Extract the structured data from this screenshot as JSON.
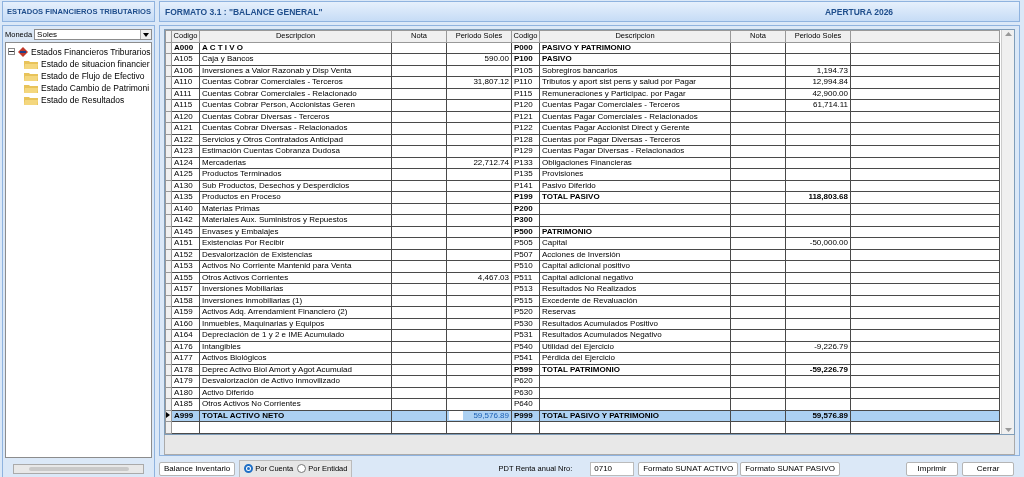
{
  "sidebar": {
    "title": "ESTADOS FINANCIEROS TRIBUTARIOS",
    "moneda": {
      "label": "Moneda",
      "value": "Soles"
    },
    "tree": {
      "label": "Estados Financieros Triburarios",
      "expanded": true,
      "children": [
        {
          "label": "Estado de situacion financier"
        },
        {
          "label": "Estado de Flujo de Efectivo"
        },
        {
          "label": "Estado Cambio de Patrimoni"
        },
        {
          "label": "Estado de Resultados"
        }
      ]
    }
  },
  "main": {
    "title": "FORMATO 3.1 : \"BALANCE GENERAL\"",
    "period": "APERTURA 2026",
    "table": {
      "columns": [
        "Codigo",
        "Descripcion",
        "Nota",
        "Periodo Soles",
        "Codigo",
        "Descripcion",
        "Nota",
        "Periodo Soles"
      ],
      "rows": [
        {
          "code": "A000",
          "desc": "A C T I V O",
          "amount": "",
          "left_bold": true,
          "code2": "P000",
          "desc2": "PASIVO Y PATRIMONIO",
          "amount2": "",
          "right_bold": true,
          "selected": false
        },
        {
          "code": "A105",
          "desc": "Caja y Bancos",
          "amount": "590.00",
          "left_bold": false,
          "code2": "P100",
          "desc2": "PASIVO",
          "amount2": "",
          "right_bold": true,
          "selected": false
        },
        {
          "code": "A106",
          "desc": "Inversiones a Valor Razonab y Disp Venta",
          "amount": "",
          "left_bold": false,
          "code2": "P105",
          "desc2": "Sobregiros bancarios",
          "amount2": "1,194.73",
          "right_bold": false,
          "selected": false
        },
        {
          "code": "A110",
          "desc": "Cuentas Cobrar Comerciales - Terceros",
          "amount": "31,807.12",
          "left_bold": false,
          "code2": "P110",
          "desc2": "Tributos y aport sist pens y salud por Pagar",
          "amount2": "12,994.84",
          "right_bold": false,
          "selected": false
        },
        {
          "code": "A111",
          "desc": "Cuentas Cobrar Comerciales - Relacionado",
          "amount": "",
          "left_bold": false,
          "code2": "P115",
          "desc2": "Remuneraciones y Participac. por Pagar",
          "amount2": "42,900.00",
          "right_bold": false,
          "selected": false
        },
        {
          "code": "A115",
          "desc": "Cuentas Cobrar Person, Accionistas Geren",
          "amount": "",
          "left_bold": false,
          "code2": "P120",
          "desc2": "Cuentas Pagar Comerciales - Terceros",
          "amount2": "61,714.11",
          "right_bold": false,
          "selected": false
        },
        {
          "code": "A120",
          "desc": "Cuentas Cobrar Diversas - Terceros",
          "amount": "",
          "left_bold": false,
          "code2": "P121",
          "desc2": "Cuentas Pagar Comerciales - Relacionados",
          "amount2": "",
          "right_bold": false,
          "selected": false
        },
        {
          "code": "A121",
          "desc": "Cuentas Cobrar Diversas - Relacionados",
          "amount": "",
          "left_bold": false,
          "code2": "P122",
          "desc2": "Cuentas Pagar Accionist Direct y Gerente",
          "amount2": "",
          "right_bold": false,
          "selected": false
        },
        {
          "code": "A122",
          "desc": "Servicios y Otros Contratados Anticipad",
          "amount": "",
          "left_bold": false,
          "code2": "P128",
          "desc2": "Cuentas por Pagar Diversas - Terceros",
          "amount2": "",
          "right_bold": false,
          "selected": false
        },
        {
          "code": "A123",
          "desc": "Estimación Cuentas Cobranza Dudosa",
          "amount": "",
          "left_bold": false,
          "code2": "P129",
          "desc2": "Cuentas Pagar Diversas - Relacionados",
          "amount2": "",
          "right_bold": false,
          "selected": false
        },
        {
          "code": "A124",
          "desc": "Mercaderias",
          "amount": "22,712.74",
          "left_bold": false,
          "code2": "P133",
          "desc2": "Obligaciones Financieras",
          "amount2": "",
          "right_bold": false,
          "selected": false
        },
        {
          "code": "A125",
          "desc": "Productos Terminados",
          "amount": "",
          "left_bold": false,
          "code2": "P135",
          "desc2": "Provisiones",
          "amount2": "",
          "right_bold": false,
          "selected": false
        },
        {
          "code": "A130",
          "desc": "Sub Productos, Desechos y Desperdicios",
          "amount": "",
          "left_bold": false,
          "code2": "P141",
          "desc2": "Pasivo Diferido",
          "amount2": "",
          "right_bold": false,
          "selected": false
        },
        {
          "code": "A135",
          "desc": "Productos en Proceso",
          "amount": "",
          "left_bold": false,
          "code2": "P199",
          "desc2": "TOTAL PASIVO",
          "amount2": "118,803.68",
          "right_bold": true,
          "selected": false
        },
        {
          "code": "A140",
          "desc": "Materias Primas",
          "amount": "",
          "left_bold": false,
          "code2": "P200",
          "desc2": "",
          "amount2": "",
          "right_bold": true,
          "selected": false
        },
        {
          "code": "A142",
          "desc": "Materiales Aux. Suministros y Repuestos",
          "amount": "",
          "left_bold": false,
          "code2": "P300",
          "desc2": "",
          "amount2": "",
          "right_bold": true,
          "selected": false
        },
        {
          "code": "A145",
          "desc": "Envases y Embalajes",
          "amount": "",
          "left_bold": false,
          "code2": "P500",
          "desc2": "PATRIMONIO",
          "amount2": "",
          "right_bold": true,
          "selected": false
        },
        {
          "code": "A151",
          "desc": "Existencias Por Recibir",
          "amount": "",
          "left_bold": false,
          "code2": "P505",
          "desc2": "Capital",
          "amount2": "-50,000.00",
          "right_bold": false,
          "selected": false
        },
        {
          "code": "A152",
          "desc": "Desvalorización de Existencias",
          "amount": "",
          "left_bold": false,
          "code2": "P507",
          "desc2": "Acciones de Inversión",
          "amount2": "",
          "right_bold": false,
          "selected": false
        },
        {
          "code": "A153",
          "desc": "Activos No Corriente Mantenid para Venta",
          "amount": "",
          "left_bold": false,
          "code2": "P510",
          "desc2": "Capital adicional positivo",
          "amount2": "",
          "right_bold": false,
          "selected": false
        },
        {
          "code": "A155",
          "desc": "Otros Activos Corrientes",
          "amount": "4,467.03",
          "left_bold": false,
          "code2": "P511",
          "desc2": "Capital adicional negativo",
          "amount2": "",
          "right_bold": false,
          "selected": false
        },
        {
          "code": "A157",
          "desc": "Inversiones Mobiliarias",
          "amount": "",
          "left_bold": false,
          "code2": "P513",
          "desc2": "Resultados No Realizados",
          "amount2": "",
          "right_bold": false,
          "selected": false
        },
        {
          "code": "A158",
          "desc": "Inversiones Inmobiliarias (1)",
          "amount": "",
          "left_bold": false,
          "code2": "P515",
          "desc2": "Excedente de Revaluación",
          "amount2": "",
          "right_bold": false,
          "selected": false
        },
        {
          "code": "A159",
          "desc": "Activos Adq. Arrendamient Financiero (2)",
          "amount": "",
          "left_bold": false,
          "code2": "P520",
          "desc2": "Reservas",
          "amount2": "",
          "right_bold": false,
          "selected": false
        },
        {
          "code": "A160",
          "desc": "Inmuebles, Maquinarias y Equipos",
          "amount": "",
          "left_bold": false,
          "code2": "P530",
          "desc2": "Resultados Acumulados Positivo",
          "amount2": "",
          "right_bold": false,
          "selected": false
        },
        {
          "code": "A164",
          "desc": "Depreciación de 1 y 2 e IME Acumulado",
          "amount": "",
          "left_bold": false,
          "code2": "P531",
          "desc2": "Resultados Acumulados Negativo",
          "amount2": "",
          "right_bold": false,
          "selected": false
        },
        {
          "code": "A176",
          "desc": "Intangibles",
          "amount": "",
          "left_bold": false,
          "code2": "P540",
          "desc2": "Utilidad del Ejercicio",
          "amount2": "-9,226.79",
          "right_bold": false,
          "selected": false
        },
        {
          "code": "A177",
          "desc": "Activos Biológicos",
          "amount": "",
          "left_bold": false,
          "code2": "P541",
          "desc2": "Pérdida del Ejercicio",
          "amount2": "",
          "right_bold": false,
          "selected": false
        },
        {
          "code": "A178",
          "desc": "Deprec Activo Biol Amort y Agot Acumulad",
          "amount": "",
          "left_bold": false,
          "code2": "P599",
          "desc2": "TOTAL PATRIMONIO",
          "amount2": "-59,226.79",
          "right_bold": true,
          "selected": false
        },
        {
          "code": "A179",
          "desc": "Desvalorización de Activo Inmovilizado",
          "amount": "",
          "left_bold": false,
          "code2": "P620",
          "desc2": "",
          "amount2": "",
          "right_bold": false,
          "selected": false
        },
        {
          "code": "A180",
          "desc": "Activo Diferido",
          "amount": "",
          "left_bold": false,
          "code2": "P630",
          "desc2": "",
          "amount2": "",
          "right_bold": false,
          "selected": false
        },
        {
          "code": "A185",
          "desc": "Otros Activos No Corrientes",
          "amount": "",
          "left_bold": false,
          "code2": "P640",
          "desc2": "",
          "amount2": "",
          "right_bold": false,
          "selected": false
        },
        {
          "code": "A999",
          "desc": "TOTAL ACTIVO NETO",
          "amount": "59,576.89",
          "left_bold": true,
          "code2": "P999",
          "desc2": "TOTAL PASIVO Y PATRIMONIO",
          "amount2": "59,576.89",
          "right_bold": true,
          "selected": true
        }
      ]
    }
  },
  "footer": {
    "inventory_button": "Balance Inventario",
    "radios": [
      {
        "label": "Por Cuenta",
        "selected": true
      },
      {
        "label": "Por Entidad",
        "selected": false
      }
    ],
    "pdt_label": "PDT Renta anual Nro:",
    "pdt_value": "0710",
    "buttons": [
      "Formato SUNAT ACTIVO",
      "Formato SUNAT PASIVO"
    ],
    "print_button": "Imprimir",
    "close_button": "Cerrar"
  }
}
